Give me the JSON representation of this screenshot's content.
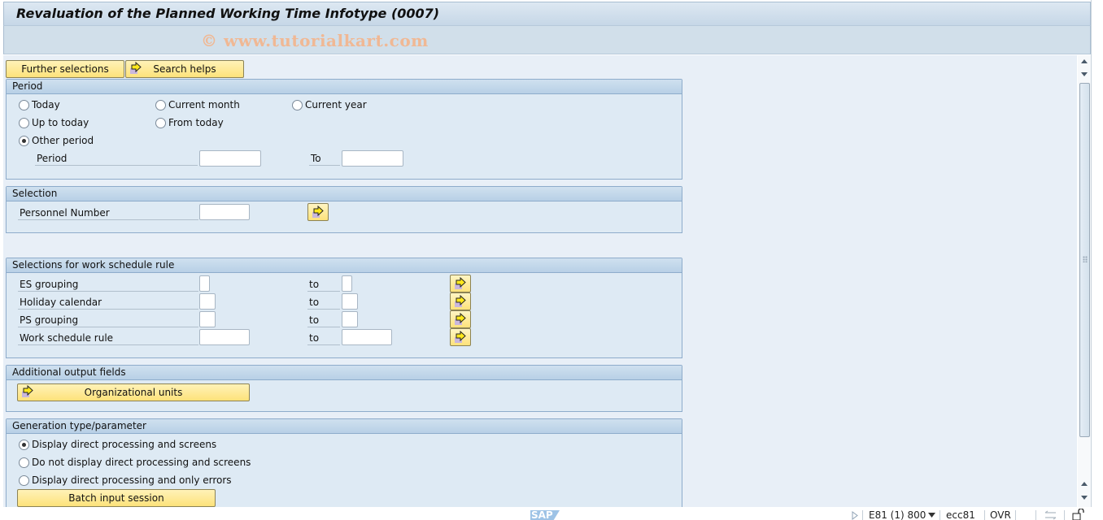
{
  "window": {
    "title": "Revaluation of the Planned Working Time Infotype (0007)",
    "watermark": "© www.tutorialkart.com"
  },
  "toolbar": {
    "further_selections_label": "Further selections",
    "search_helps_label": "Search helps"
  },
  "period_group": {
    "title": "Period",
    "options": [
      {
        "label": "Today",
        "checked": false
      },
      {
        "label": "Current month",
        "checked": false
      },
      {
        "label": "Current year",
        "checked": false
      },
      {
        "label": "Up to today",
        "checked": false
      },
      {
        "label": "From today",
        "checked": false
      },
      {
        "label": "Other period",
        "checked": true
      }
    ],
    "period_label": "Period",
    "period_from_value": "",
    "to_label": "To",
    "period_to_value": ""
  },
  "selection_group": {
    "title": "Selection",
    "personnel_number_label": "Personnel Number",
    "personnel_number_value": ""
  },
  "wsr_group": {
    "title": "Selections for work schedule rule",
    "rows": [
      {
        "label": "ES grouping",
        "from": "",
        "to_label": "to",
        "to": ""
      },
      {
        "label": "Holiday calendar",
        "from": "",
        "to_label": "to",
        "to": ""
      },
      {
        "label": "PS grouping",
        "from": "",
        "to_label": "to",
        "to": ""
      },
      {
        "label": "Work schedule rule",
        "from": "",
        "to_label": "to",
        "to": ""
      }
    ]
  },
  "output_group": {
    "title": "Additional output fields",
    "org_units_label": "Organizational units"
  },
  "generation_group": {
    "title": "Generation type/parameter",
    "options": [
      {
        "label": "Display direct processing and screens",
        "checked": true
      },
      {
        "label": "Do not display direct processing and screens",
        "checked": false
      },
      {
        "label": "Display direct processing and only errors",
        "checked": false
      }
    ],
    "batch_input_label": "Batch input session"
  },
  "status_bar": {
    "logo": "SAP",
    "system": "E81 (1) 800",
    "server": "ecc81",
    "mode": "OVR"
  }
}
